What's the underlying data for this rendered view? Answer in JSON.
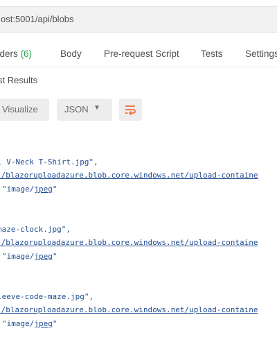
{
  "request": {
    "url": "ost:5001/api/blobs"
  },
  "tabs": [
    {
      "label": "aders",
      "count": "(6)"
    },
    {
      "label": "Body"
    },
    {
      "label": "Pre-request Script"
    },
    {
      "label": "Tests"
    },
    {
      "label": "Settings"
    }
  ],
  "results": {
    "label": "st Results"
  },
  "toolbar": {
    "visualize_label": "Visualize",
    "format_label": "JSON",
    "format_caret": "▼"
  },
  "colors": {
    "accent": "#f26b3a",
    "count": "#26a44a",
    "string": "#1f4b8f"
  },
  "body": {
    "items": [
      {
        "name": "l V-Neck T-Shirt.jpg\",",
        "uri": "'/blazoruploadazure.blob.core.windows.net/upload-containe",
        "type_open": "\"image/",
        "type_link": "jpeg",
        "type_close": "\""
      },
      {
        "name": "maze-clock.jpg\",",
        "uri": "'/blazoruploadazure.blob.core.windows.net/upload-containe",
        "type_open": "\"image/",
        "type_link": "jpeg",
        "type_close": "\""
      },
      {
        "name": "leeve-code-maze.jpg\",",
        "uri": "'/blazoruploadazure.blob.core.windows.net/upload-containe",
        "type_open": "\"image/",
        "type_link": "jpeg",
        "type_close": "\""
      }
    ]
  }
}
